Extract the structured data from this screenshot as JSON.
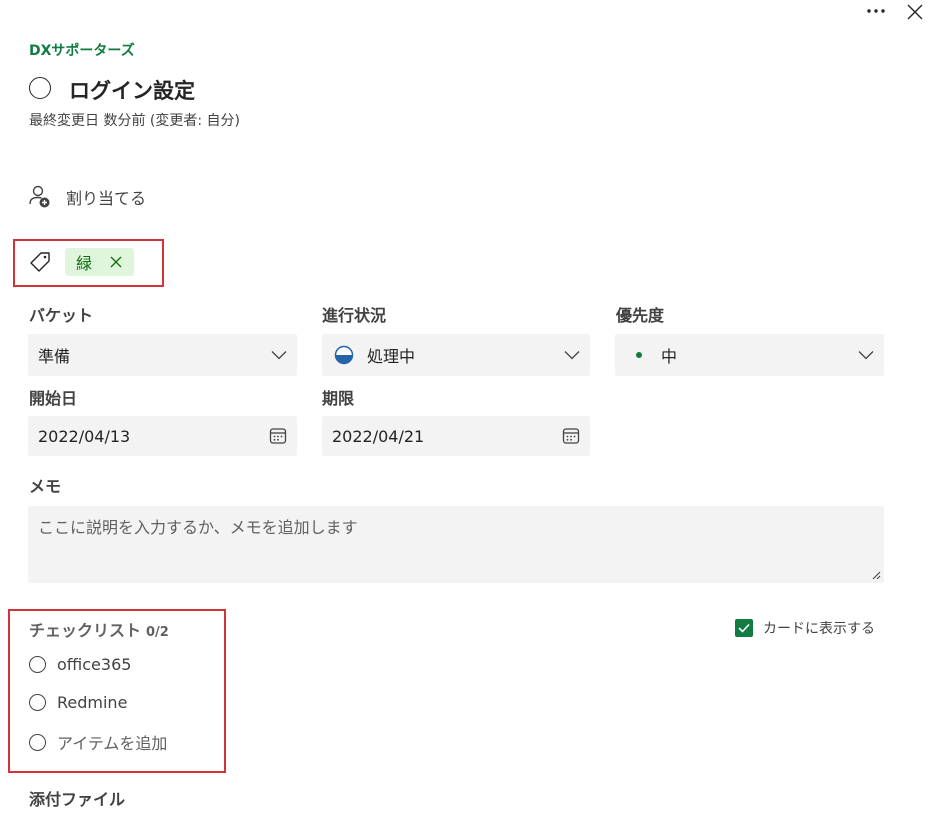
{
  "header": {
    "more_icon": "more-horizontal-icon",
    "close_icon": "close-icon"
  },
  "plan_name": "DXサポーターズ",
  "task": {
    "title": "ログイン設定",
    "modified": "最終変更日 数分前 (変更者: 自分)"
  },
  "assign": {
    "label": "割り当てる"
  },
  "labels": {
    "tag": "緑",
    "tag_color": "#dff6dd",
    "tag_text_color": "#0e700e"
  },
  "fields": {
    "bucket_label": "バケット",
    "bucket_value": "準備",
    "progress_label": "進行状況",
    "progress_value": "処理中",
    "priority_label": "優先度",
    "priority_value": "中",
    "start_label": "開始日",
    "start_value": "2022/04/13",
    "due_label": "期限",
    "due_value": "2022/04/21"
  },
  "notes": {
    "label": "メモ",
    "placeholder": "ここに説明を入力するか、メモを追加します"
  },
  "checklist": {
    "label": "チェックリスト",
    "count": "0/2",
    "show_on_card": "カードに表示する",
    "items": [
      "office365",
      "Redmine"
    ],
    "add_item": "アイテムを追加"
  },
  "attachments": {
    "label": "添付ファイル"
  },
  "colors": {
    "accent_green": "#107c41",
    "highlight_red": "#d13438"
  }
}
